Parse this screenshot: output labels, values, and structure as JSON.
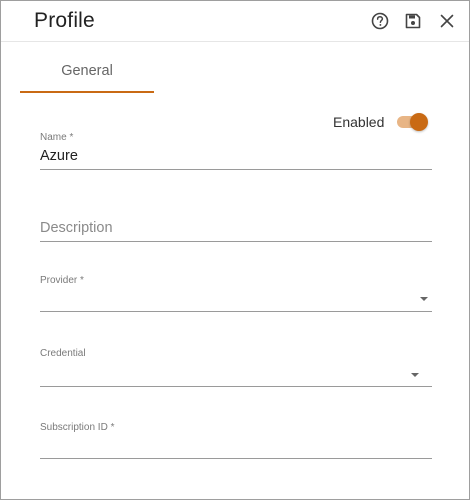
{
  "header": {
    "title": "Profile",
    "icons": [
      "help-circle-icon",
      "save-icon",
      "close-icon"
    ]
  },
  "tabs": [
    {
      "label": "General",
      "active": true
    }
  ],
  "toggle": {
    "label": "Enabled",
    "on": true,
    "accent_color": "#c96a14",
    "track_color": "#e8b585"
  },
  "form": {
    "name": {
      "label": "Name *",
      "value": "Azure"
    },
    "description": {
      "placeholder": "Description",
      "value": ""
    },
    "provider": {
      "label": "Provider *",
      "value": ""
    },
    "credential": {
      "label": "Credential",
      "value": ""
    },
    "subscription_id": {
      "label": "Subscription ID *",
      "value": ""
    }
  }
}
